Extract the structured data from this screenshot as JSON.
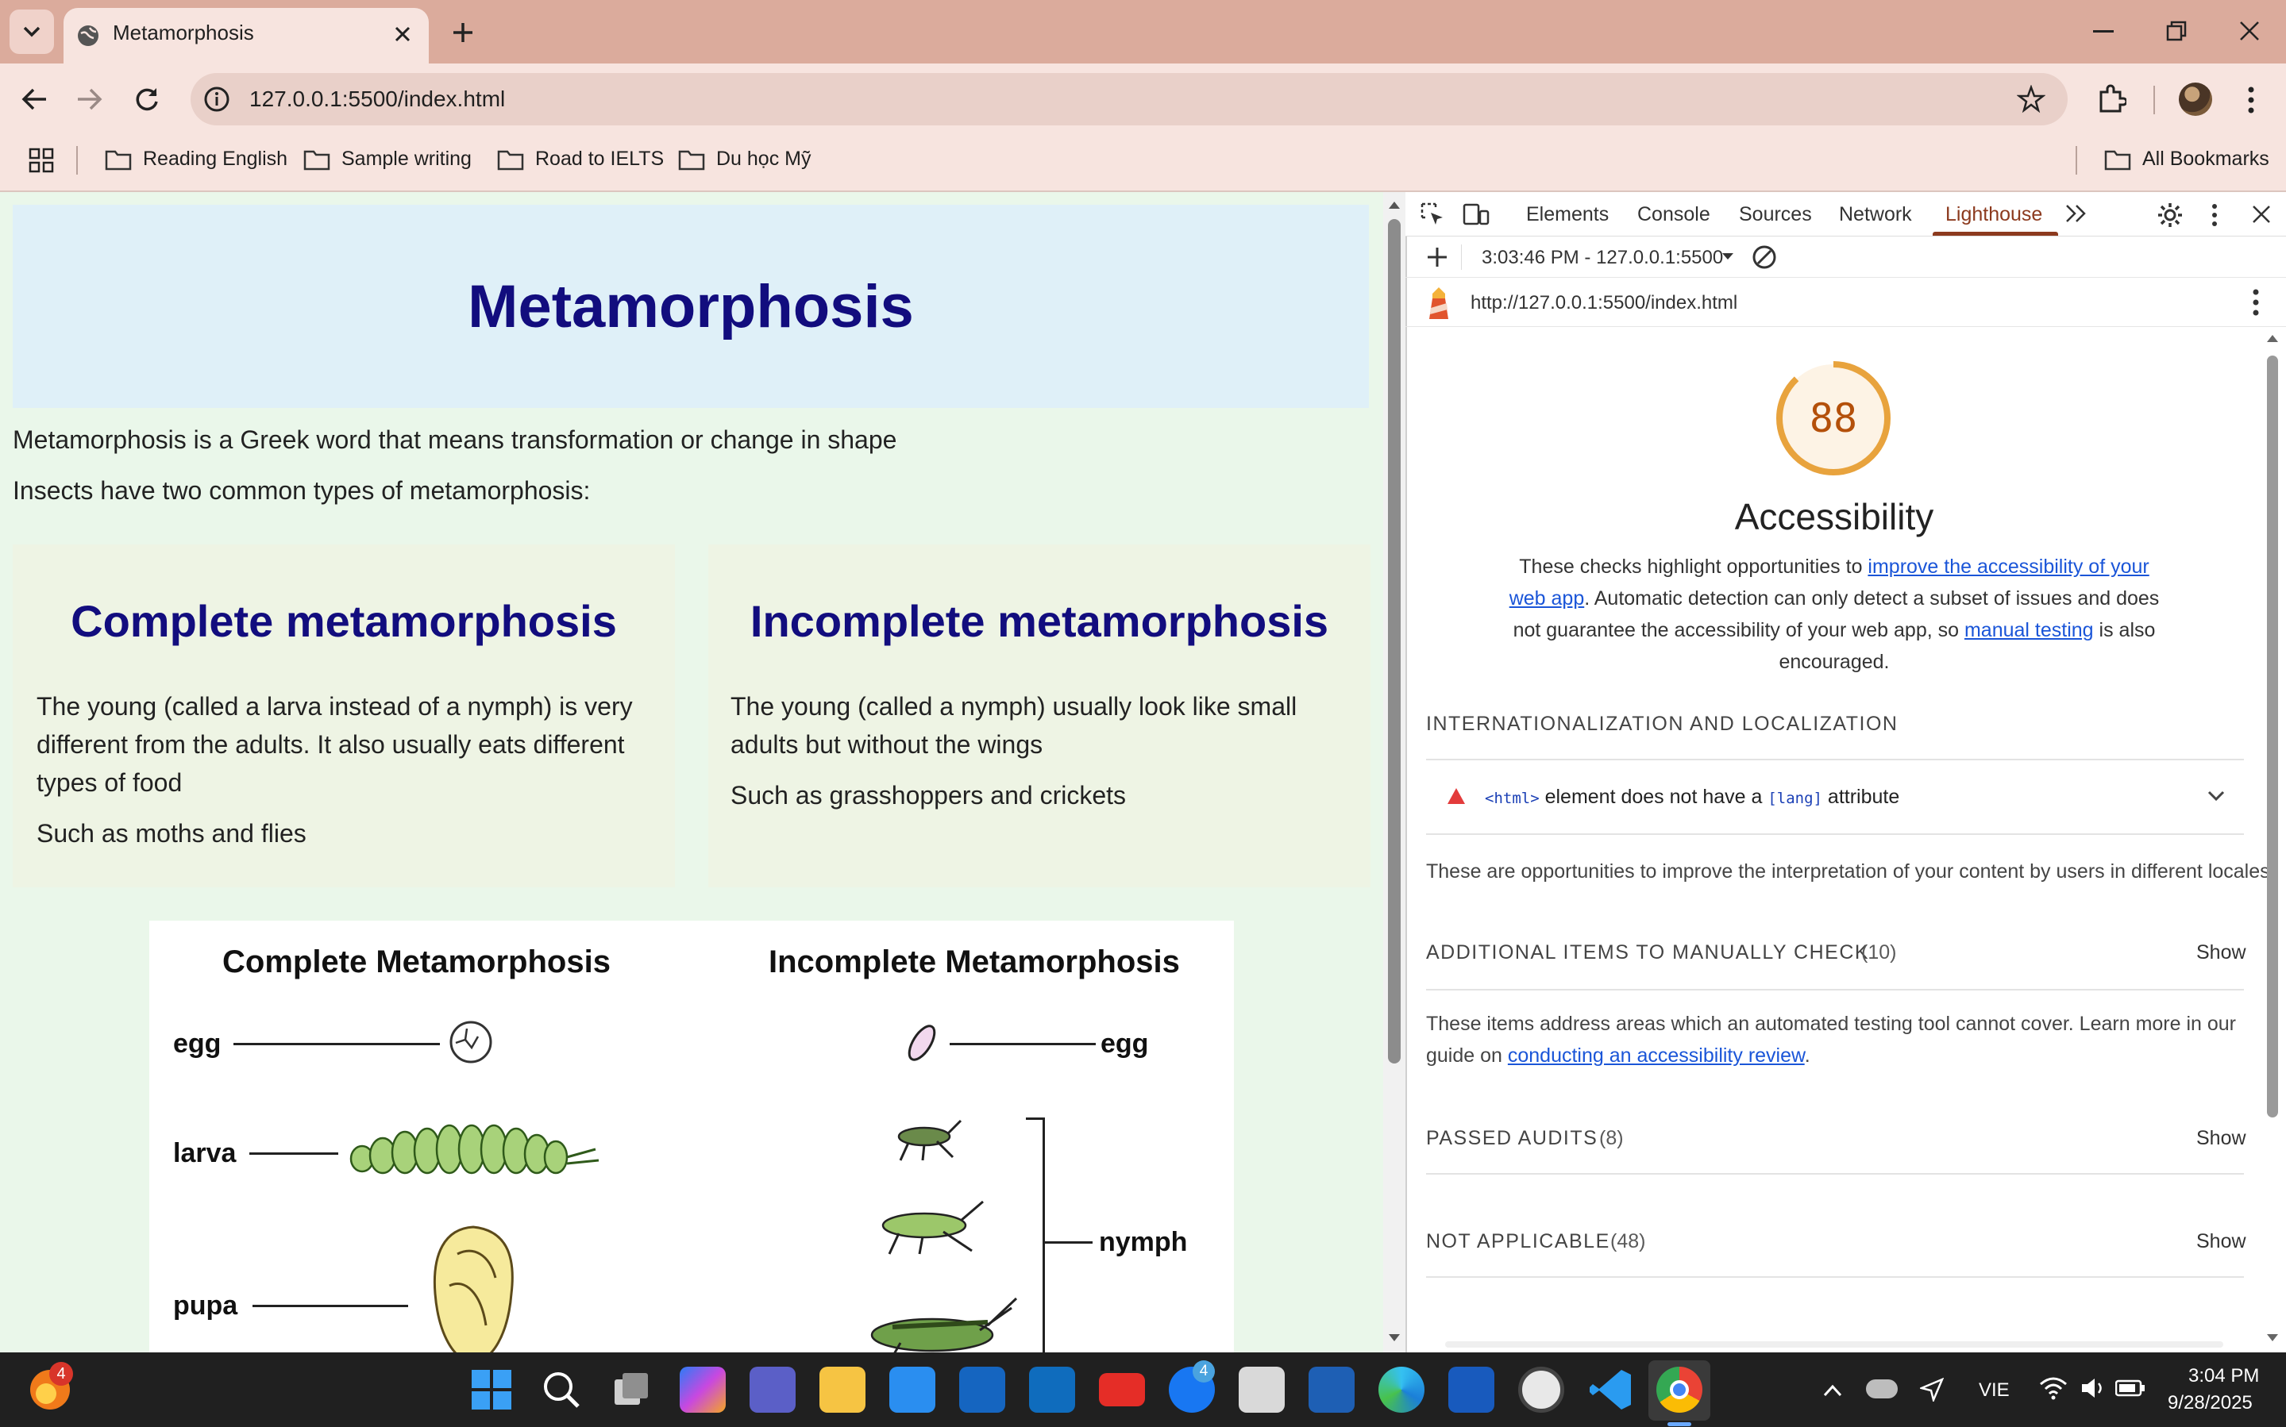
{
  "browser": {
    "tab_title": "Metamorphosis",
    "url": "127.0.0.1:5500/index.html",
    "bookmarks": [
      "Reading English",
      "Sample writing",
      "Road to IELTS",
      "Du học Mỹ"
    ],
    "all_bookmarks": "All Bookmarks"
  },
  "page": {
    "title": "Metamorphosis",
    "intro": "Metamorphosis is a Greek word that means transformation or change in shape",
    "intro2": "Insects have two common types of metamorphosis:",
    "complete": {
      "heading": "Complete metamorphosis",
      "text": "The young (called a larva instead of a nymph) is very different from the adults. It also usually eats different types of food",
      "example": "Such as moths and flies"
    },
    "incomplete": {
      "heading": "Incomplete metamorphosis",
      "text": "The young (called a nymph) usually look like small adults but without the wings",
      "example": "Such as grasshoppers and crickets"
    },
    "figure": {
      "complete_title": "Complete Metamorphosis",
      "incomplete_title": "Incomplete Metamorphosis",
      "egg": "egg",
      "larva": "larva",
      "pupa": "pupa",
      "egg2": "egg",
      "nymph": "nymph"
    }
  },
  "devtools": {
    "tabs": [
      "Elements",
      "Console",
      "Sources",
      "Network",
      "Lighthouse"
    ],
    "active_tab": "Lighthouse",
    "report_select": "3:03:46 PM - 127.0.0.1:5500",
    "report_url": "http://127.0.0.1:5500/index.html",
    "score": "88",
    "score_fraction": 0.88,
    "score_color": "#e8a33d",
    "category": "Accessibility",
    "desc_1": "These checks highlight opportunities to ",
    "desc_link1": "improve the accessibility of your web app",
    "desc_2": ". Automatic detection can only detect a subset of issues and does not guarantee the accessibility of your web app, so ",
    "desc_link2": "manual testing",
    "desc_3": " is also encouraged.",
    "section_i18n": "INTERNATIONALIZATION AND LOCALIZATION",
    "audit_code1": "<html>",
    "audit_text": " element does not have a ",
    "audit_code2": "[lang]",
    "audit_text2": " attribute",
    "i18n_note": "These are opportunities to improve the interpretation of your content by users in different locales.",
    "manual_title": "ADDITIONAL ITEMS TO MANUALLY CHECK",
    "manual_count": "(10)",
    "manual_note_1": "These items address areas which an automated testing tool cannot cover. Learn more in our guide on ",
    "manual_link": "conducting an accessibility review",
    "manual_note_2": ".",
    "passed_title": "PASSED AUDITS",
    "passed_count": "(8)",
    "na_title": "NOT APPLICABLE",
    "na_count": "(48)",
    "show": "Show"
  },
  "taskbar": {
    "badge_left": "4",
    "badge_fb": "4",
    "lang": "VIE",
    "time": "3:04 PM",
    "date": "9/28/2025"
  }
}
